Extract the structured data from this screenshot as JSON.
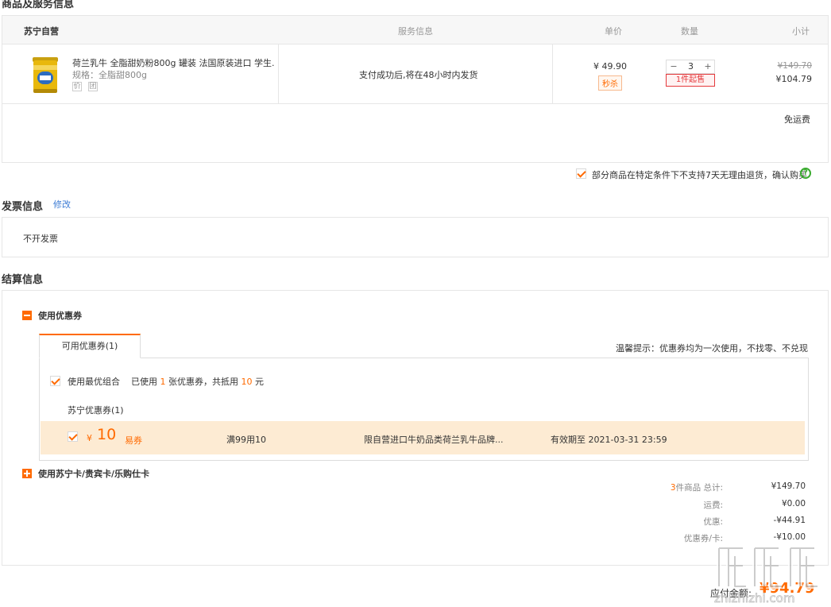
{
  "goods_section": {
    "title": "商品及服务信息",
    "columns": {
      "store": "苏宁自营",
      "service": "服务信息",
      "price": "单价",
      "qty": "数量",
      "subtotal": "小计"
    },
    "item": {
      "name": "荷兰乳牛 全脂甜奶粉800g 罐装 法国原装进口 学生...",
      "spec": "规格：全脂甜800g",
      "icon_labels": [
        "价",
        "团"
      ],
      "service": "支付成功后,将在48小时内发货",
      "price": "¥ 49.90",
      "price_tag": "秒杀",
      "qty_minus": "−",
      "qty_value": "3",
      "qty_plus": "+",
      "min_qty_note": "1件起售",
      "original_subtotal": "¥149.70",
      "subtotal": "¥104.79"
    },
    "shipping": "免运费",
    "return_notice": "部分商品在特定条件下不支持7天无理由退货，确认购买",
    "help_icon": "?"
  },
  "invoice_section": {
    "title": "发票信息",
    "edit_link": "修改",
    "value": "不开发票"
  },
  "settlement_section": {
    "title": "结算信息",
    "coupon_toggle_label": "使用优惠券",
    "coupon_tab": "可用优惠券(1)",
    "coupon_tip": "温馨提示：优惠券均为一次使用，不找零、不兑现",
    "best_combo": {
      "label": "使用最优组合",
      "prefix": "已使用",
      "count": "1",
      "middle": "张优惠券，共抵用",
      "amount": "10",
      "suffix": "元"
    },
    "coupon_group": "苏宁优惠券(1)",
    "coupon": {
      "currency": "¥",
      "amount": "10",
      "type": "易券",
      "condition": "满99用10",
      "scope": "限自营进口牛奶品类荷兰乳牛品牌...",
      "expiry": "有效期至 2021-03-31 23:59"
    },
    "card_toggle_label": "使用苏宁卡/贵宾卡/乐购仕卡"
  },
  "summary": {
    "item_count": "3",
    "total_label": "件商品 总计:",
    "total": "¥149.70",
    "shipping_label": "运费:",
    "shipping": "¥0.00",
    "discount_label": "优惠:",
    "discount": "-¥44.91",
    "coupon_label": "优惠券/卡:",
    "coupon": "-¥10.00",
    "payable_label": "应付金额:",
    "payable": "¥94.79"
  },
  "watermark": "值 值 值 zhizhizhi.com",
  "colors": {
    "accent": "#ff6a00",
    "link": "#3c7bd4",
    "coupon_bg": "#fdebd3",
    "help_green": "#3aab2f"
  }
}
